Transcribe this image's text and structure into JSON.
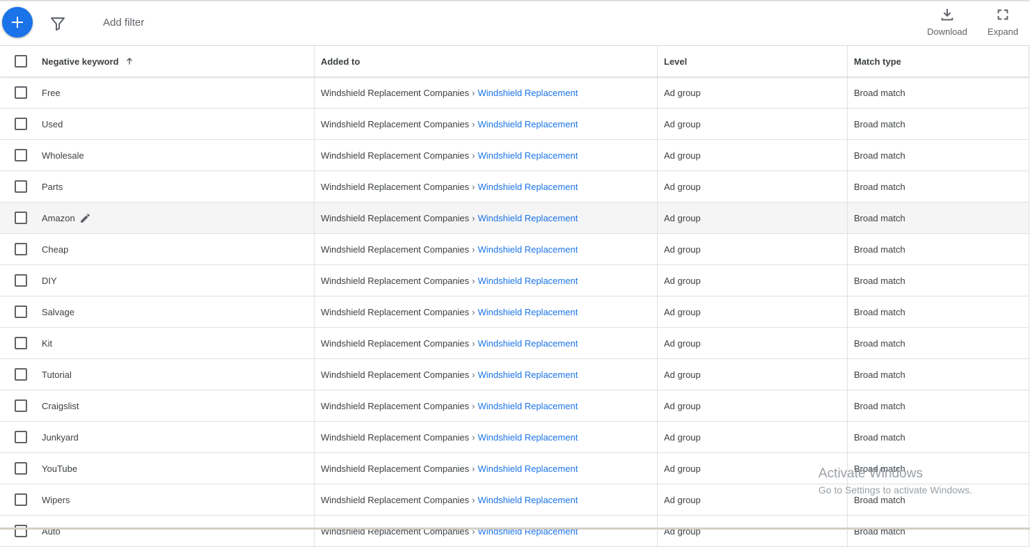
{
  "toolbar": {
    "add_filter_label": "Add filter",
    "download_label": "Download",
    "expand_label": "Expand"
  },
  "table": {
    "headers": {
      "keyword": "Negative keyword",
      "added_to": "Added to",
      "level": "Level",
      "match_type": "Match type"
    },
    "rows": [
      {
        "keyword": "Free",
        "campaign": "Windshield Replacement Companies",
        "separator": "›",
        "ad_group": "Windshield Replacement",
        "level": "Ad group",
        "match_type": "Broad match"
      },
      {
        "keyword": "Used",
        "campaign": "Windshield Replacement Companies",
        "separator": "›",
        "ad_group": "Windshield Replacement",
        "level": "Ad group",
        "match_type": "Broad match"
      },
      {
        "keyword": "Wholesale",
        "campaign": "Windshield Replacement Companies",
        "separator": "›",
        "ad_group": "Windshield Replacement",
        "level": "Ad group",
        "match_type": "Broad match"
      },
      {
        "keyword": "Parts",
        "campaign": "Windshield Replacement Companies",
        "separator": "›",
        "ad_group": "Windshield Replacement",
        "level": "Ad group",
        "match_type": "Broad match"
      },
      {
        "keyword": "Amazon",
        "campaign": "Windshield Replacement Companies",
        "separator": "›",
        "ad_group": "Windshield Replacement",
        "level": "Ad group",
        "match_type": "Broad match"
      },
      {
        "keyword": "Cheap",
        "campaign": "Windshield Replacement Companies",
        "separator": "›",
        "ad_group": "Windshield Replacement",
        "level": "Ad group",
        "match_type": "Broad match"
      },
      {
        "keyword": "DIY",
        "campaign": "Windshield Replacement Companies",
        "separator": "›",
        "ad_group": "Windshield Replacement",
        "level": "Ad group",
        "match_type": "Broad match"
      },
      {
        "keyword": "Salvage",
        "campaign": "Windshield Replacement Companies",
        "separator": "›",
        "ad_group": "Windshield Replacement",
        "level": "Ad group",
        "match_type": "Broad match"
      },
      {
        "keyword": "Kit",
        "campaign": "Windshield Replacement Companies",
        "separator": "›",
        "ad_group": "Windshield Replacement",
        "level": "Ad group",
        "match_type": "Broad match"
      },
      {
        "keyword": "Tutorial",
        "campaign": "Windshield Replacement Companies",
        "separator": "›",
        "ad_group": "Windshield Replacement",
        "level": "Ad group",
        "match_type": "Broad match"
      },
      {
        "keyword": "Craigslist",
        "campaign": "Windshield Replacement Companies",
        "separator": "›",
        "ad_group": "Windshield Replacement",
        "level": "Ad group",
        "match_type": "Broad match"
      },
      {
        "keyword": "Junkyard",
        "campaign": "Windshield Replacement Companies",
        "separator": "›",
        "ad_group": "Windshield Replacement",
        "level": "Ad group",
        "match_type": "Broad match"
      },
      {
        "keyword": "YouTube",
        "campaign": "Windshield Replacement Companies",
        "separator": "›",
        "ad_group": "Windshield Replacement",
        "level": "Ad group",
        "match_type": "Broad match"
      },
      {
        "keyword": "Wipers",
        "campaign": "Windshield Replacement Companies",
        "separator": "›",
        "ad_group": "Windshield Replacement",
        "level": "Ad group",
        "match_type": "Broad match"
      },
      {
        "keyword": "Auto",
        "campaign": "Windshield Replacement Companies",
        "separator": "›",
        "ad_group": "Windshield Replacement",
        "level": "Ad group",
        "match_type": "Broad match"
      }
    ]
  },
  "watermark": {
    "line1": "Activate Windows",
    "line2": "Go to Settings to activate Windows."
  },
  "colors": {
    "accent": "#1a73e8",
    "text": "#3c4043",
    "link": "#1a73e8"
  },
  "icons": [
    "add-icon",
    "filter-icon",
    "download-icon",
    "expand-icon",
    "sort-arrow-up-icon",
    "edit-pencil-icon"
  ]
}
